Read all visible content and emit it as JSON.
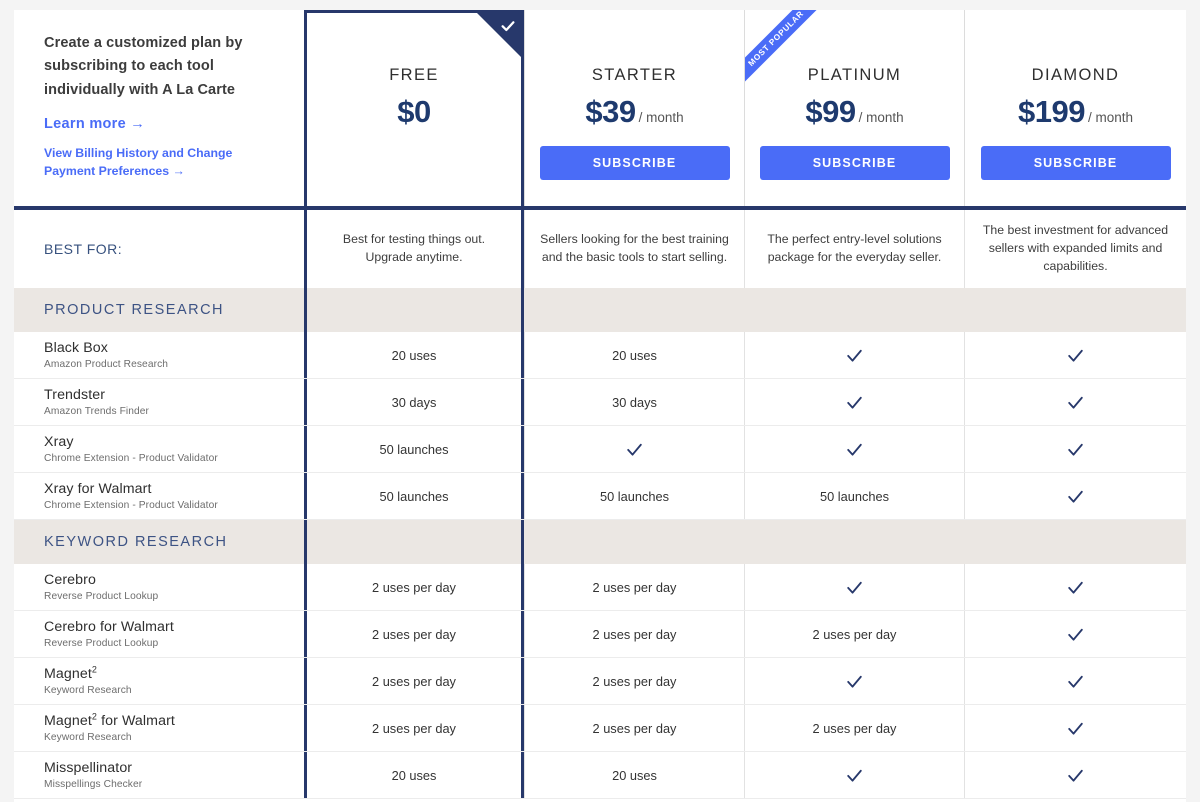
{
  "intro": {
    "description": "Create a customized plan by subscribing to each tool individually with A La Carte",
    "learn_more": "Learn more →",
    "billing_link": "View Billing History and Change Payment Preferences →"
  },
  "plans": [
    {
      "name": "FREE",
      "price": "$0",
      "period": "",
      "cta": "",
      "selected": true,
      "badge": "",
      "corner_icon": "check-icon",
      "best_for": "Best for testing things out. Upgrade anytime."
    },
    {
      "name": "STARTER",
      "price": "$39",
      "period": "/ month",
      "cta": "SUBSCRIBE",
      "selected": false,
      "badge": "",
      "corner_icon": "",
      "best_for": "Sellers looking for the best training and the basic tools to start selling."
    },
    {
      "name": "PLATINUM",
      "price": "$99",
      "period": "/ month",
      "cta": "SUBSCRIBE",
      "selected": false,
      "badge": "MOST POPULAR",
      "corner_icon": "",
      "best_for": "The perfect entry-level solutions package for the everyday seller."
    },
    {
      "name": "DIAMOND",
      "price": "$199",
      "period": "/ month",
      "cta": "SUBSCRIBE",
      "selected": false,
      "badge": "",
      "corner_icon": "",
      "best_for": "The best investment for advanced sellers with expanded limits and capabilities."
    }
  ],
  "best_for_label": "BEST FOR:",
  "sections": [
    {
      "title": "PRODUCT RESEARCH",
      "rows": [
        {
          "name": "Black Box",
          "name_sup": "",
          "subtitle": "Amazon Product Research",
          "values": [
            "20 uses",
            "20 uses",
            "check",
            "check"
          ]
        },
        {
          "name": "Trendster",
          "name_sup": "",
          "subtitle": "Amazon Trends Finder",
          "values": [
            "30 days",
            "30 days",
            "check",
            "check"
          ]
        },
        {
          "name": "Xray",
          "name_sup": "",
          "subtitle": "Chrome Extension - Product Validator",
          "values": [
            "50 launches",
            "check",
            "check",
            "check"
          ]
        },
        {
          "name": "Xray for Walmart",
          "name_sup": "",
          "subtitle": "Chrome Extension - Product Validator",
          "values": [
            "50 launches",
            "50 launches",
            "50 launches",
            "check"
          ]
        }
      ]
    },
    {
      "title": "KEYWORD RESEARCH",
      "rows": [
        {
          "name": "Cerebro",
          "name_sup": "",
          "subtitle": "Reverse Product Lookup",
          "values": [
            "2 uses per day",
            "2 uses per day",
            "check",
            "check"
          ]
        },
        {
          "name": "Cerebro for Walmart",
          "name_sup": "",
          "subtitle": "Reverse Product Lookup",
          "values": [
            "2 uses per day",
            "2 uses per day",
            "2 uses per day",
            "check"
          ]
        },
        {
          "name": "Magnet",
          "name_sup": "2",
          "subtitle": "Keyword Research",
          "values": [
            "2 uses per day",
            "2 uses per day",
            "check",
            "check"
          ]
        },
        {
          "name": "Magnet",
          "name_sup": "2",
          "name_after": " for Walmart",
          "subtitle": "Keyword Research",
          "values": [
            "2 uses per day",
            "2 uses per day",
            "2 uses per day",
            "check"
          ]
        },
        {
          "name": "Misspellinator",
          "name_sup": "",
          "subtitle": "Misspellings Checker",
          "values": [
            "20 uses",
            "20 uses",
            "check",
            "check"
          ]
        }
      ]
    }
  ],
  "colors": {
    "navy": "#27386b",
    "accent_blue": "#4a6cf7",
    "price_navy": "#1e3a6e",
    "band_bg": "#ebe7e3",
    "page_bg": "#f4f4f4"
  }
}
